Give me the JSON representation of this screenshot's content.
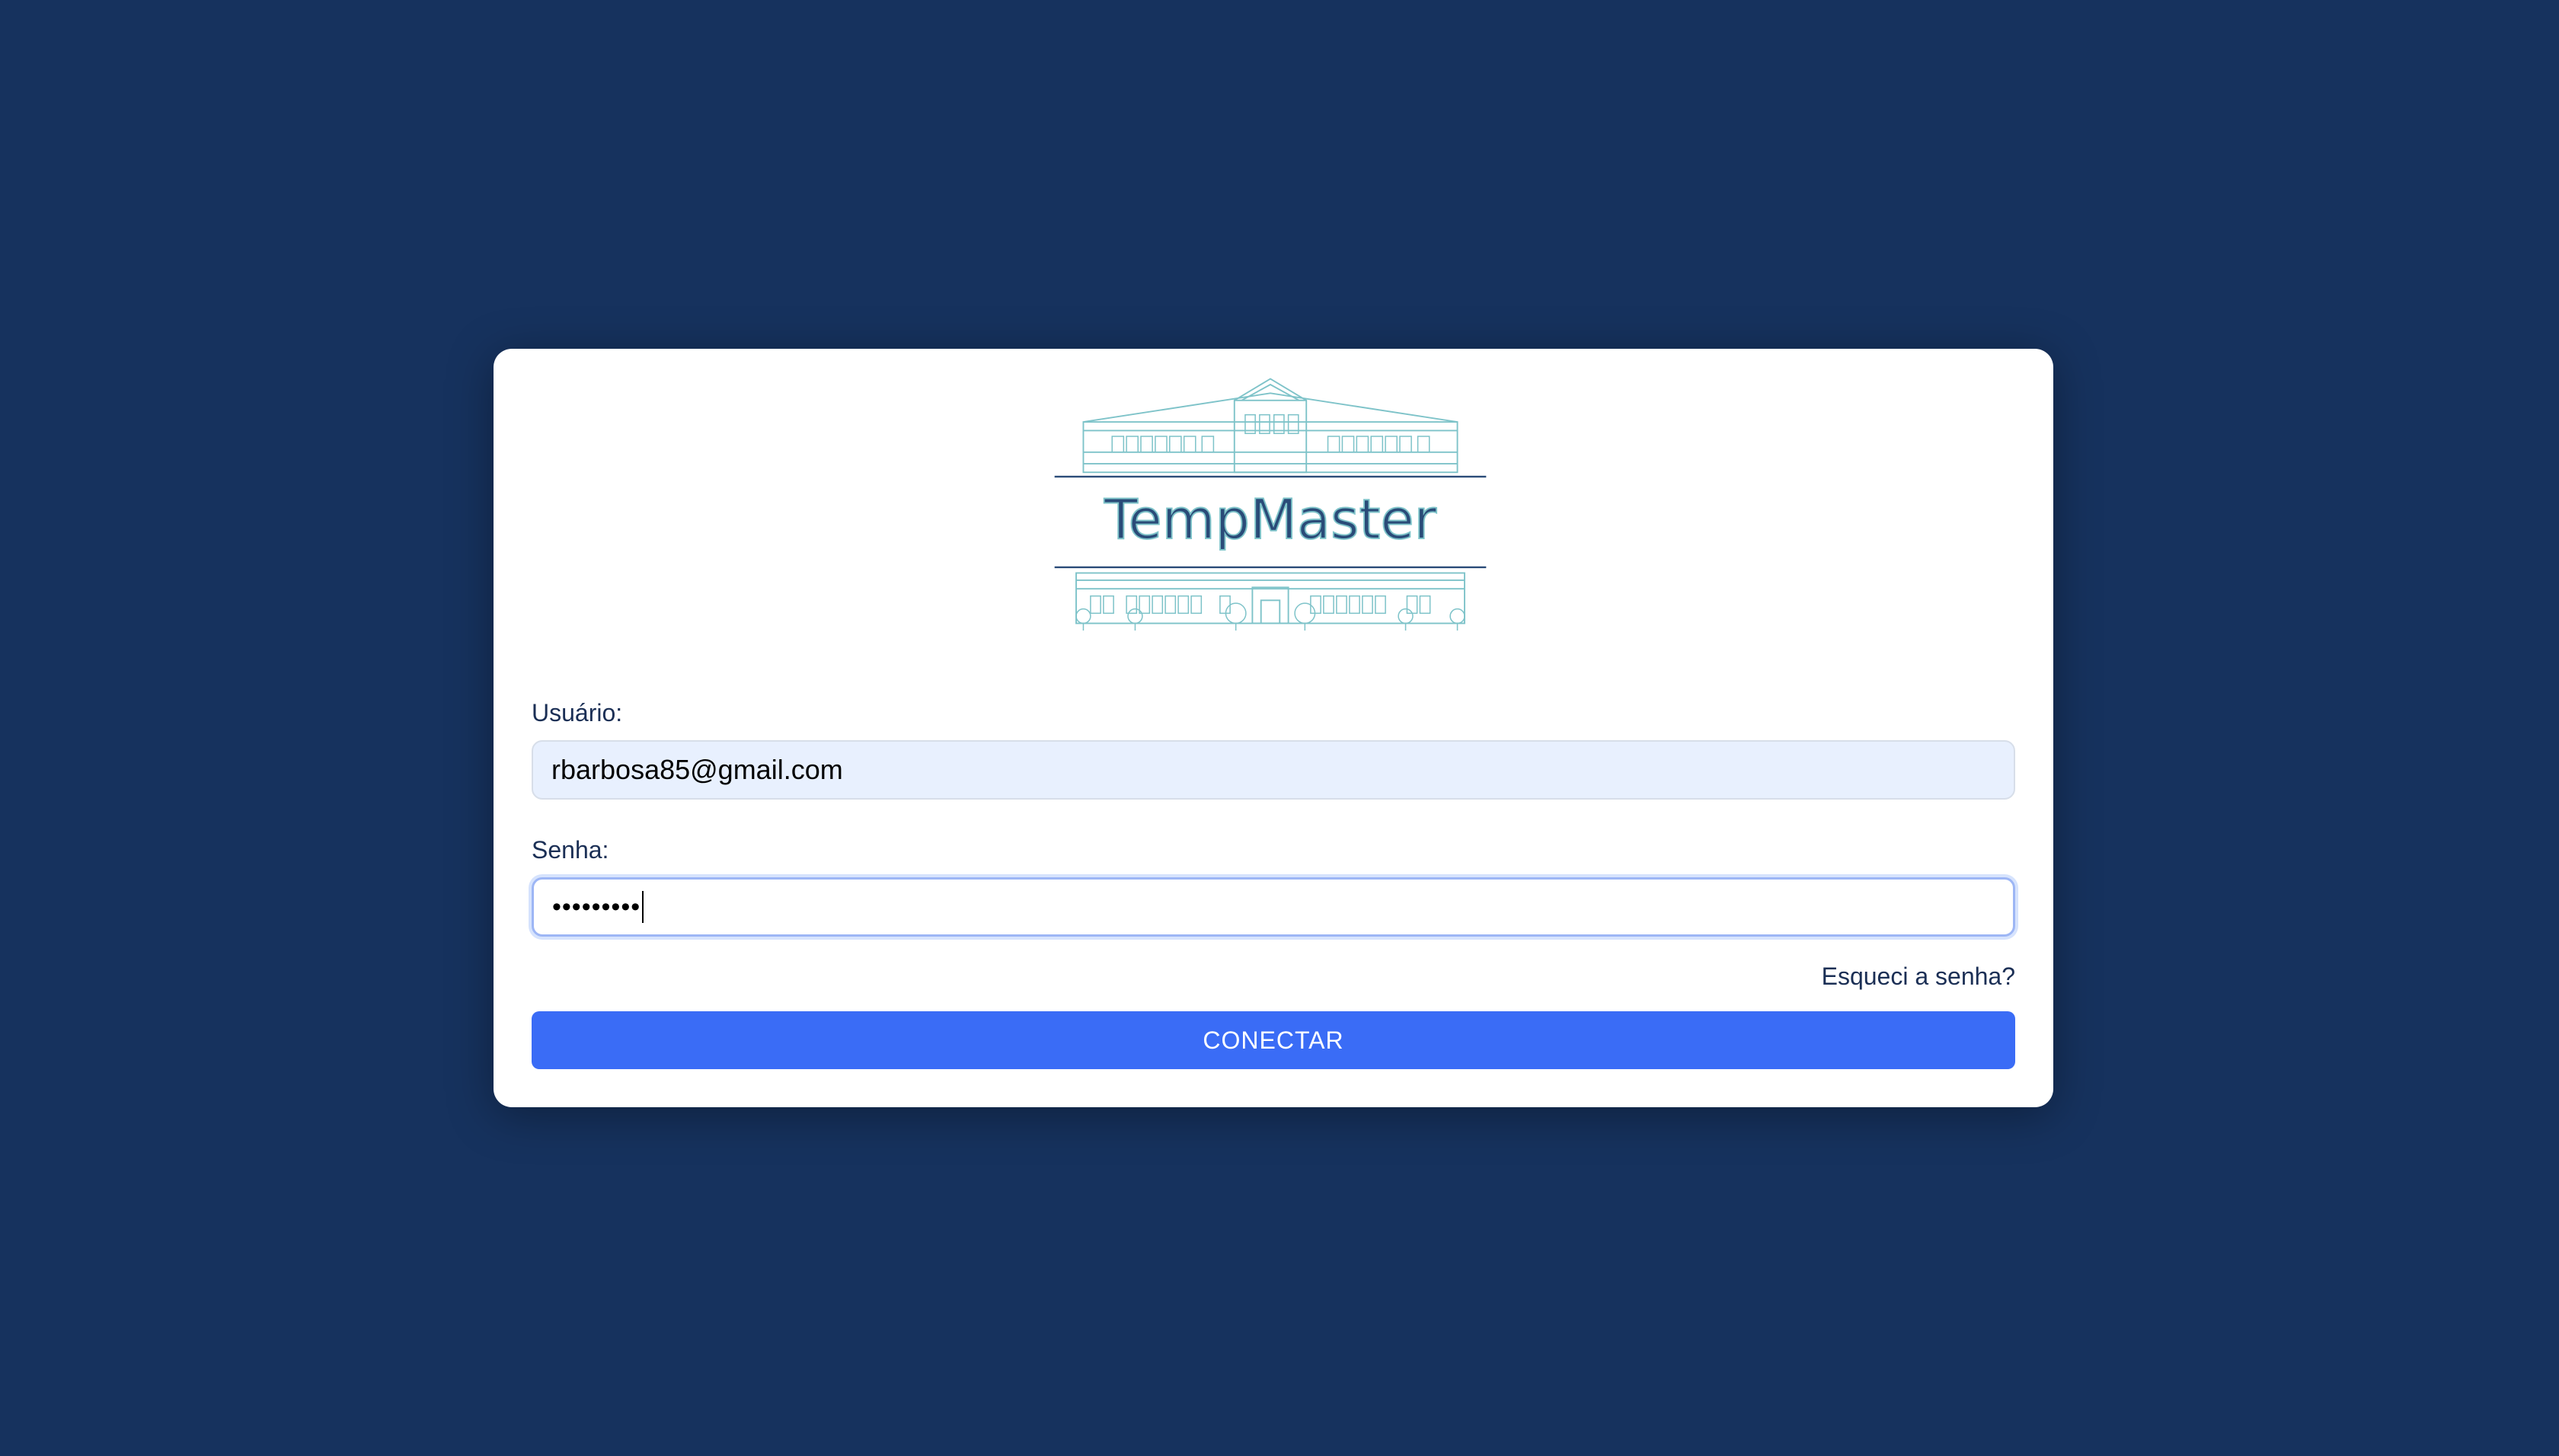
{
  "logo": {
    "text": "TempMaster",
    "line_color": "#7ec3c9",
    "text_color": "#2a4b78"
  },
  "form": {
    "user_label": "Usuário:",
    "user_value": "rbarbosa85@gmail.com",
    "password_label": "Senha:",
    "password_value": "•••••••••",
    "forgot_link": "Esqueci a senha?",
    "submit_label": "CONECTAR"
  },
  "colors": {
    "background": "#16325e",
    "button": "#3a6cf6",
    "input_filled_bg": "#e8f0fe",
    "focus_ring": "#9db6f5"
  }
}
